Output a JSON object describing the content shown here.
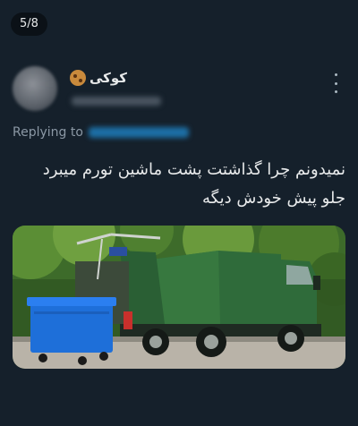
{
  "media_counter": "5/8",
  "tweet": {
    "display_name": "کوکی",
    "name_emoji": "cookie-emoji",
    "replying_to_label": "Replying to",
    "text_lines": [
      "نمیدونم چرا گذاشتت پشت ماشین تورم میبرد",
      "جلو پیش خودش دیگه"
    ]
  },
  "image": {
    "subject": "green garbage truck with a blue wheelie bin",
    "truck_color": "#2f6b3a",
    "bin_color": "#1e6fd9"
  },
  "colors": {
    "background": "#15202b",
    "text": "#e7e9ea",
    "muted": "#8b98a5"
  }
}
